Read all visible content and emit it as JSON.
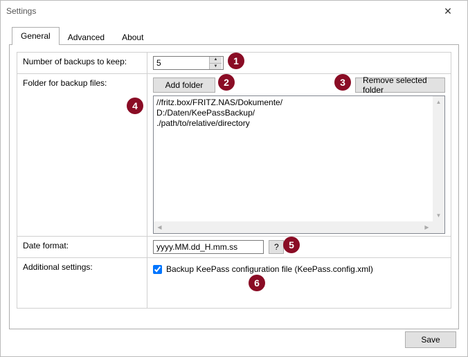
{
  "window": {
    "title": "Settings",
    "close_icon": "✕"
  },
  "tabs": {
    "general": "General",
    "advanced": "Advanced",
    "about": "About"
  },
  "labels": {
    "backupsToKeep": "Number of backups to keep:",
    "folderForBackups": "Folder for backup files:",
    "dateFormat": "Date format:",
    "additional": "Additional settings:"
  },
  "values": {
    "backupCount": "5",
    "dateFormat": "yyyy.MM.dd_H.mm.ss"
  },
  "buttons": {
    "addFolder": "Add folder",
    "removeFolder": "Remove selected folder",
    "help": "?",
    "save": "Save"
  },
  "folders": [
    "//fritz.box/FRITZ.NAS/Dokumente/",
    "D:/Daten/KeePassBackup/",
    "./path/to/relative/directory"
  ],
  "checkbox": {
    "label": "Backup KeePass configuration file (KeePass.config.xml)",
    "checked": true
  },
  "callouts": {
    "c1": "1",
    "c2": "2",
    "c3": "3",
    "c4": "4",
    "c5": "5",
    "c6": "6"
  }
}
